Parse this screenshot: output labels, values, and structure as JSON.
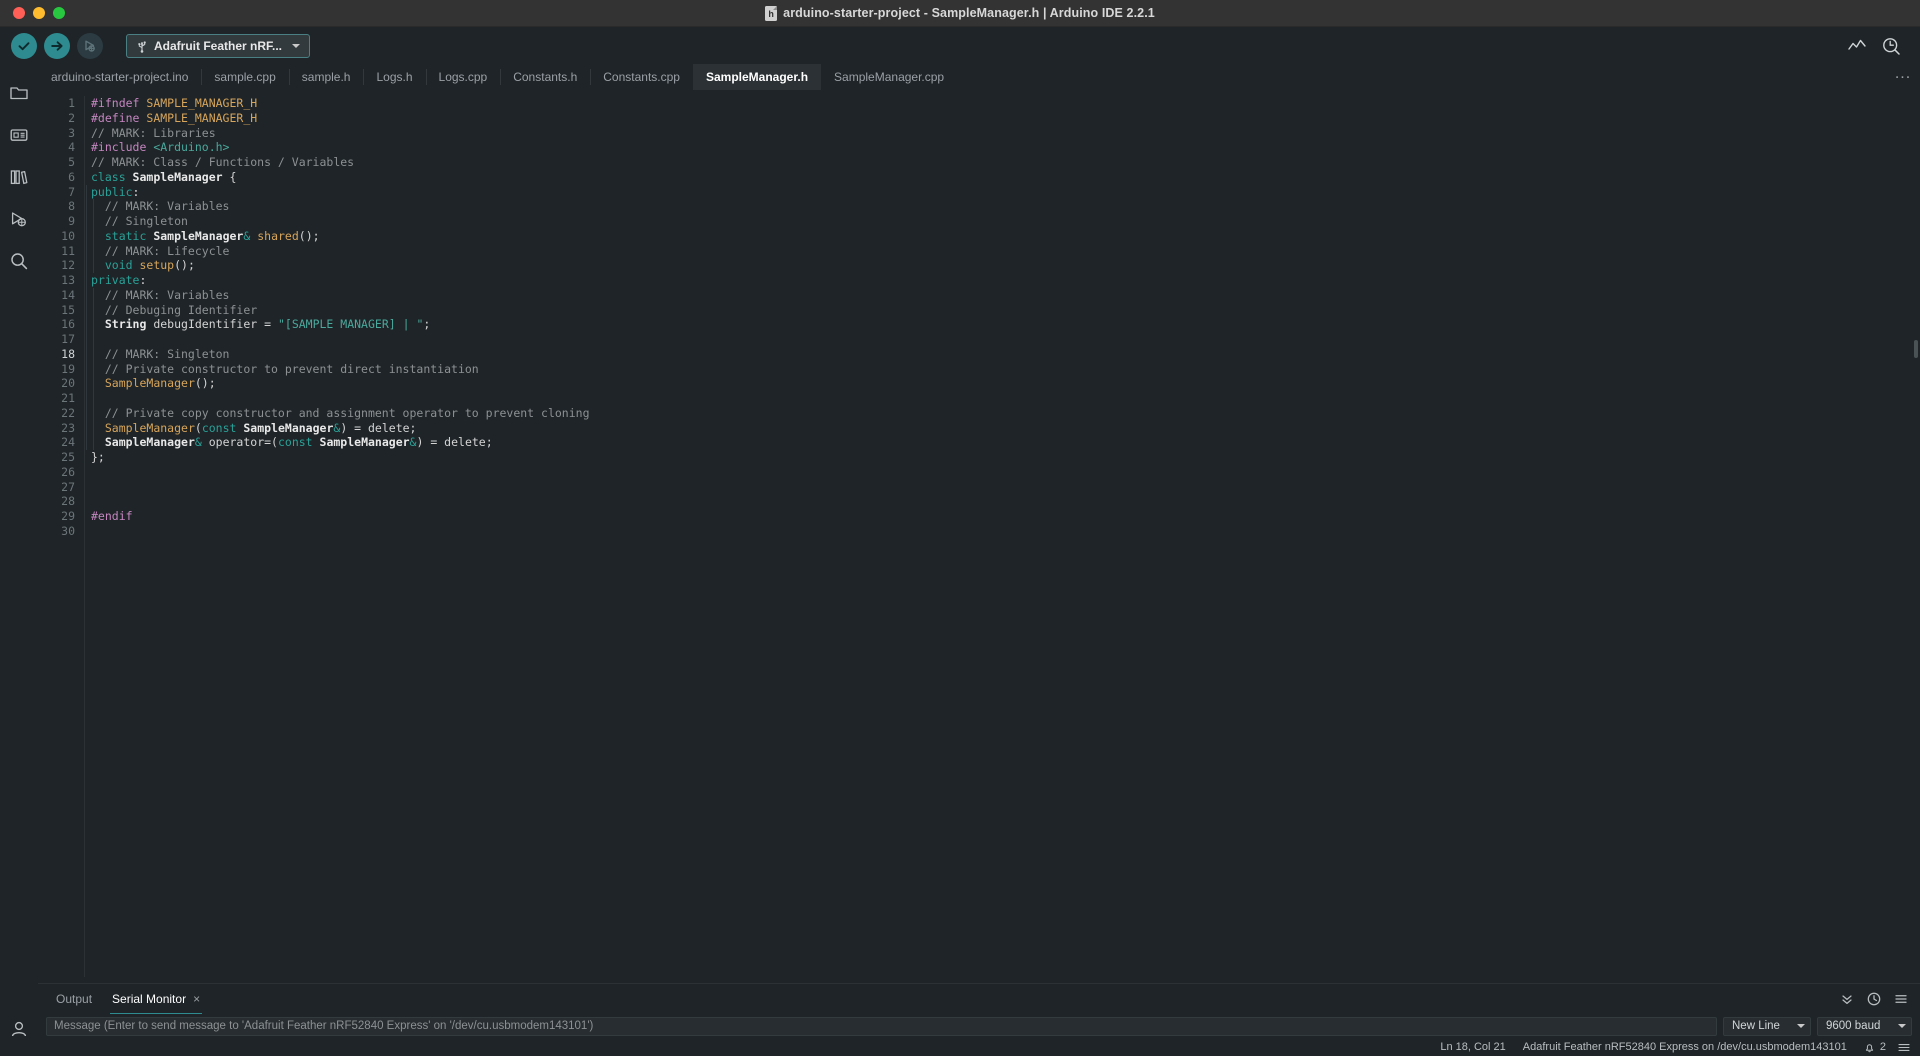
{
  "window": {
    "title": "arduino-starter-project - SampleManager.h | Arduino IDE 2.2.1",
    "file_icon": "h"
  },
  "toolbar": {
    "verify_label": "Verify",
    "upload_label": "Upload",
    "debug_label": "Debug",
    "board_selector": "Adafruit Feather nRF...",
    "serial_plotter_label": "Serial Plotter",
    "serial_monitor_label": "Serial Monitor"
  },
  "activity_bar": {
    "items": [
      {
        "name": "sketchbook",
        "icon": "folder-icon"
      },
      {
        "name": "boards-manager",
        "icon": "board-icon"
      },
      {
        "name": "library-manager",
        "icon": "library-icon"
      },
      {
        "name": "debug",
        "icon": "debug-icon"
      },
      {
        "name": "search",
        "icon": "search-icon"
      }
    ],
    "bottom": {
      "name": "account",
      "icon": "account-icon"
    }
  },
  "tabs": {
    "items": [
      {
        "label": "arduino-starter-project.ino",
        "active": false
      },
      {
        "label": "sample.cpp",
        "active": false
      },
      {
        "label": "sample.h",
        "active": false
      },
      {
        "label": "Logs.h",
        "active": false
      },
      {
        "label": "Logs.cpp",
        "active": false
      },
      {
        "label": "Constants.h",
        "active": false
      },
      {
        "label": "Constants.cpp",
        "active": false
      },
      {
        "label": "SampleManager.h",
        "active": true
      },
      {
        "label": "SampleManager.cpp",
        "active": false
      }
    ],
    "overflow_label": "..."
  },
  "editor": {
    "current_line": 18,
    "lines": [
      {
        "n": 1,
        "tokens": [
          {
            "t": "#ifndef ",
            "c": "t-pre"
          },
          {
            "t": "SAMPLE_MANAGER_H",
            "c": "t-macro"
          }
        ]
      },
      {
        "n": 2,
        "tokens": [
          {
            "t": "#define ",
            "c": "t-pre"
          },
          {
            "t": "SAMPLE_MANAGER_H",
            "c": "t-macro"
          }
        ]
      },
      {
        "n": 3,
        "tokens": [
          {
            "t": "// MARK: Libraries",
            "c": "t-cmt"
          }
        ]
      },
      {
        "n": 4,
        "tokens": [
          {
            "t": "#include ",
            "c": "t-pre"
          },
          {
            "t": "<Arduino.h>",
            "c": "t-inc"
          }
        ]
      },
      {
        "n": 5,
        "tokens": [
          {
            "t": "// MARK: Class / Functions / Variables",
            "c": "t-cmt"
          }
        ]
      },
      {
        "n": 6,
        "tokens": [
          {
            "t": "class ",
            "c": "t-key"
          },
          {
            "t": "SampleManager",
            "c": "t-type"
          },
          {
            "t": " {",
            "c": "t-plain"
          }
        ]
      },
      {
        "n": 7,
        "tokens": [
          {
            "t": "public",
            "c": "t-key"
          },
          {
            "t": ":",
            "c": "t-plain"
          }
        ]
      },
      {
        "n": 8,
        "tokens": [
          {
            "t": "  // MARK: Variables",
            "c": "t-cmt"
          }
        ]
      },
      {
        "n": 9,
        "tokens": [
          {
            "t": "  // Singleton",
            "c": "t-cmt"
          }
        ]
      },
      {
        "n": 10,
        "tokens": [
          {
            "t": "  ",
            "c": "t-plain"
          },
          {
            "t": "static ",
            "c": "t-key"
          },
          {
            "t": "SampleManager",
            "c": "t-type"
          },
          {
            "t": "&",
            "c": "t-key"
          },
          {
            "t": " ",
            "c": "t-plain"
          },
          {
            "t": "shared",
            "c": "t-fn"
          },
          {
            "t": "();",
            "c": "t-plain"
          }
        ]
      },
      {
        "n": 11,
        "tokens": [
          {
            "t": "  // MARK: Lifecycle",
            "c": "t-cmt"
          }
        ]
      },
      {
        "n": 12,
        "tokens": [
          {
            "t": "  ",
            "c": "t-plain"
          },
          {
            "t": "void ",
            "c": "t-key"
          },
          {
            "t": "setup",
            "c": "t-fn"
          },
          {
            "t": "();",
            "c": "t-plain"
          }
        ]
      },
      {
        "n": 13,
        "tokens": [
          {
            "t": "private",
            "c": "t-key"
          },
          {
            "t": ":",
            "c": "t-plain"
          }
        ]
      },
      {
        "n": 14,
        "tokens": [
          {
            "t": "  // MARK: Variables",
            "c": "t-cmt"
          }
        ]
      },
      {
        "n": 15,
        "tokens": [
          {
            "t": "  // Debuging Identifier",
            "c": "t-cmt"
          }
        ]
      },
      {
        "n": 16,
        "tokens": [
          {
            "t": "  ",
            "c": "t-plain"
          },
          {
            "t": "String",
            "c": "t-type"
          },
          {
            "t": " debugIdentifier = ",
            "c": "t-plain"
          },
          {
            "t": "\"[SAMPLE MANAGER] | \"",
            "c": "t-str"
          },
          {
            "t": ";",
            "c": "t-plain"
          }
        ]
      },
      {
        "n": 17,
        "tokens": []
      },
      {
        "n": 18,
        "tokens": [
          {
            "t": "  // MARK: Singleton",
            "c": "t-cmt"
          }
        ]
      },
      {
        "n": 19,
        "tokens": [
          {
            "t": "  // Private constructor to prevent direct instantiation",
            "c": "t-cmt"
          }
        ]
      },
      {
        "n": 20,
        "tokens": [
          {
            "t": "  ",
            "c": "t-plain"
          },
          {
            "t": "SampleManager",
            "c": "t-fn"
          },
          {
            "t": "();",
            "c": "t-plain"
          }
        ]
      },
      {
        "n": 21,
        "tokens": []
      },
      {
        "n": 22,
        "tokens": [
          {
            "t": "  // Private copy constructor and assignment operator to prevent cloning",
            "c": "t-cmt"
          }
        ]
      },
      {
        "n": 23,
        "tokens": [
          {
            "t": "  ",
            "c": "t-plain"
          },
          {
            "t": "SampleManager",
            "c": "t-fn"
          },
          {
            "t": "(",
            "c": "t-plain"
          },
          {
            "t": "const ",
            "c": "t-key"
          },
          {
            "t": "SampleManager",
            "c": "t-type"
          },
          {
            "t": "&",
            "c": "t-key"
          },
          {
            "t": ") = delete;",
            "c": "t-plain"
          }
        ]
      },
      {
        "n": 24,
        "tokens": [
          {
            "t": "  ",
            "c": "t-plain"
          },
          {
            "t": "SampleManager",
            "c": "t-type"
          },
          {
            "t": "&",
            "c": "t-key"
          },
          {
            "t": " operator=(",
            "c": "t-plain"
          },
          {
            "t": "const ",
            "c": "t-key"
          },
          {
            "t": "SampleManager",
            "c": "t-type"
          },
          {
            "t": "&",
            "c": "t-key"
          },
          {
            "t": ") = delete;",
            "c": "t-plain"
          }
        ]
      },
      {
        "n": 25,
        "tokens": [
          {
            "t": "};",
            "c": "t-plain"
          }
        ]
      },
      {
        "n": 26,
        "tokens": []
      },
      {
        "n": 27,
        "tokens": []
      },
      {
        "n": 28,
        "tokens": []
      },
      {
        "n": 29,
        "tokens": [
          {
            "t": "#endif",
            "c": "t-pre"
          }
        ]
      },
      {
        "n": 30,
        "tokens": []
      }
    ]
  },
  "panel": {
    "tabs": [
      {
        "label": "Output",
        "active": false,
        "closeable": false
      },
      {
        "label": "Serial Monitor",
        "active": true,
        "closeable": true
      }
    ],
    "close_glyph": "×",
    "chevron_glyph": "⌄",
    "clock_label": "timestamp-toggle",
    "menu_label": "panel-menu"
  },
  "serial": {
    "placeholder": "Message (Enter to send message to 'Adafruit Feather nRF52840 Express' on '/dev/cu.usbmodem143101')",
    "value": "",
    "line_ending": "New Line",
    "baud_rate": "9600 baud"
  },
  "status": {
    "cursor": "Ln 18, Col 21",
    "board_port": "Adafruit Feather nRF52840 Express on /dev/cu.usbmodem143101",
    "notification_count": "2"
  },
  "colors": {
    "accent": "#2e8b90",
    "titlebar_bg": "#333333",
    "editor_bg": "#1e2427",
    "tab_active_bg": "#2b3134"
  }
}
